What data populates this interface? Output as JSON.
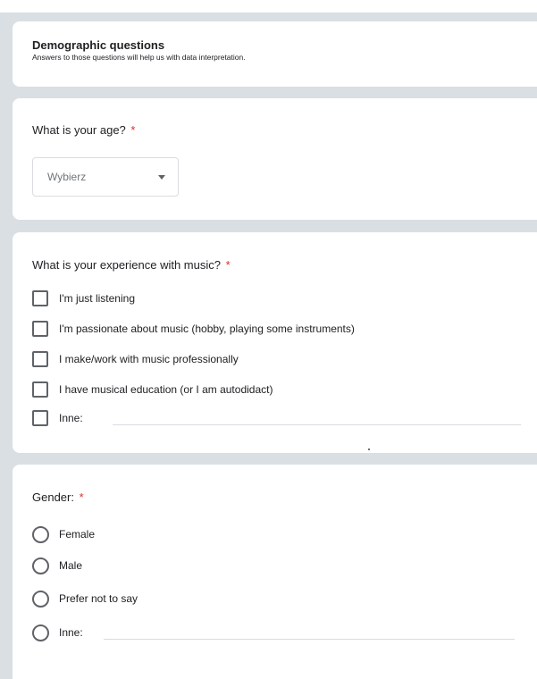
{
  "section": {
    "title": "Demographic questions",
    "description": "Answers to those questions will help us with data interpretation."
  },
  "questions": {
    "age": {
      "title": "What is your age?",
      "required_mark": "*",
      "dropdown_value": "Wybierz"
    },
    "music": {
      "title": "What is your experience with music?",
      "required_mark": "*",
      "options": [
        "I'm just listening",
        "I'm passionate about music (hobby, playing some instruments)",
        "I make/work with music professionally",
        "I have musical education (or I am autodidact)",
        "Inne:"
      ]
    },
    "gender": {
      "title": "Gender:",
      "required_mark": "*",
      "options": [
        "Female",
        "Male",
        "Prefer not to say",
        "Inne:"
      ]
    }
  },
  "colors": {
    "page_background": "#d9dfe3",
    "card_background": "#ffffff",
    "required": "#d93025",
    "control_border": "#5f6368",
    "placeholder_text": "#70757a"
  },
  "icons": {
    "dropdown": "caret-down-icon",
    "checkbox": "checkbox-unchecked-icon",
    "radio": "radio-unchecked-icon"
  }
}
